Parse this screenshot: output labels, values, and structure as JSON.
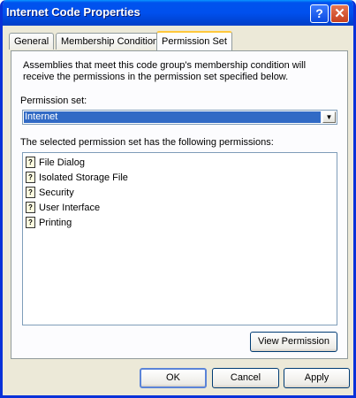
{
  "window": {
    "title": "Internet Code Properties",
    "help_glyph": "?",
    "close_glyph": "✕"
  },
  "tabs": [
    "General",
    "Membership Condition",
    "Permission Set"
  ],
  "content": {
    "description": "Assemblies that meet this code group's membership condition will receive the permissions in the permission set specified below.",
    "permission_set_label": "Permission set:",
    "permission_set_value": "Internet",
    "permissions_label": "The selected permission set has the following permissions:",
    "permissions": [
      "File Dialog",
      "Isolated Storage File",
      "Security",
      "User Interface",
      "Printing"
    ],
    "permission_icon_glyph": "?",
    "view_permission_label": "View Permission"
  },
  "buttons": {
    "ok": "OK",
    "cancel": "Cancel",
    "apply": "Apply"
  },
  "colors": {
    "title_bar": "#0050ee",
    "selection": "#316ac5",
    "active_tab_accent": "#ffc83c",
    "dialog_bg": "#ece9d8"
  }
}
